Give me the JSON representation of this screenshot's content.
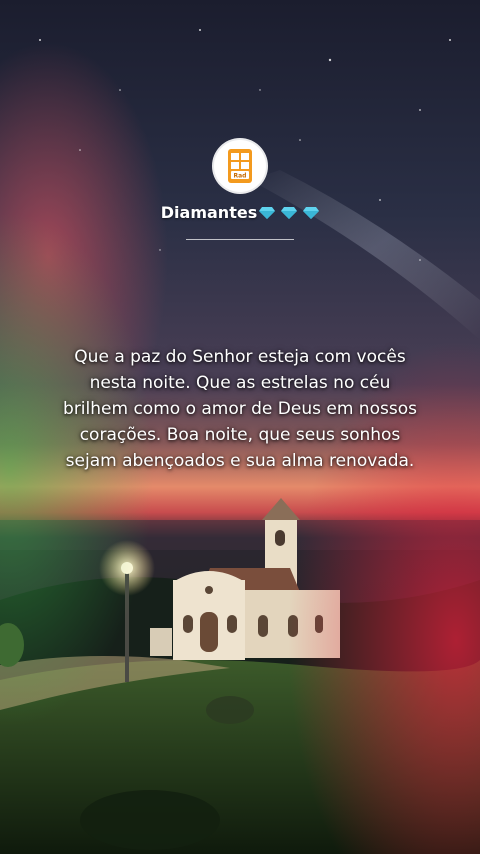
{
  "profile": {
    "username": "Diamantes",
    "badge_icons": [
      "diamond-icon",
      "diamond-icon",
      "diamond-icon"
    ],
    "avatar_icon": "phone-logo-icon",
    "avatar_text": "Rad"
  },
  "post": {
    "message": "Que a paz do Senhor esteja com vocês nesta noite. Que as estrelas no céu brilhem como o amor de Deus em nossos corações. Boa noite, que seus sonhos sejam abençoados e sua alma renovada."
  },
  "colors": {
    "text": "#ffffff",
    "diamond": "#5fd3ee",
    "logo_orange": "#f39a1e"
  }
}
